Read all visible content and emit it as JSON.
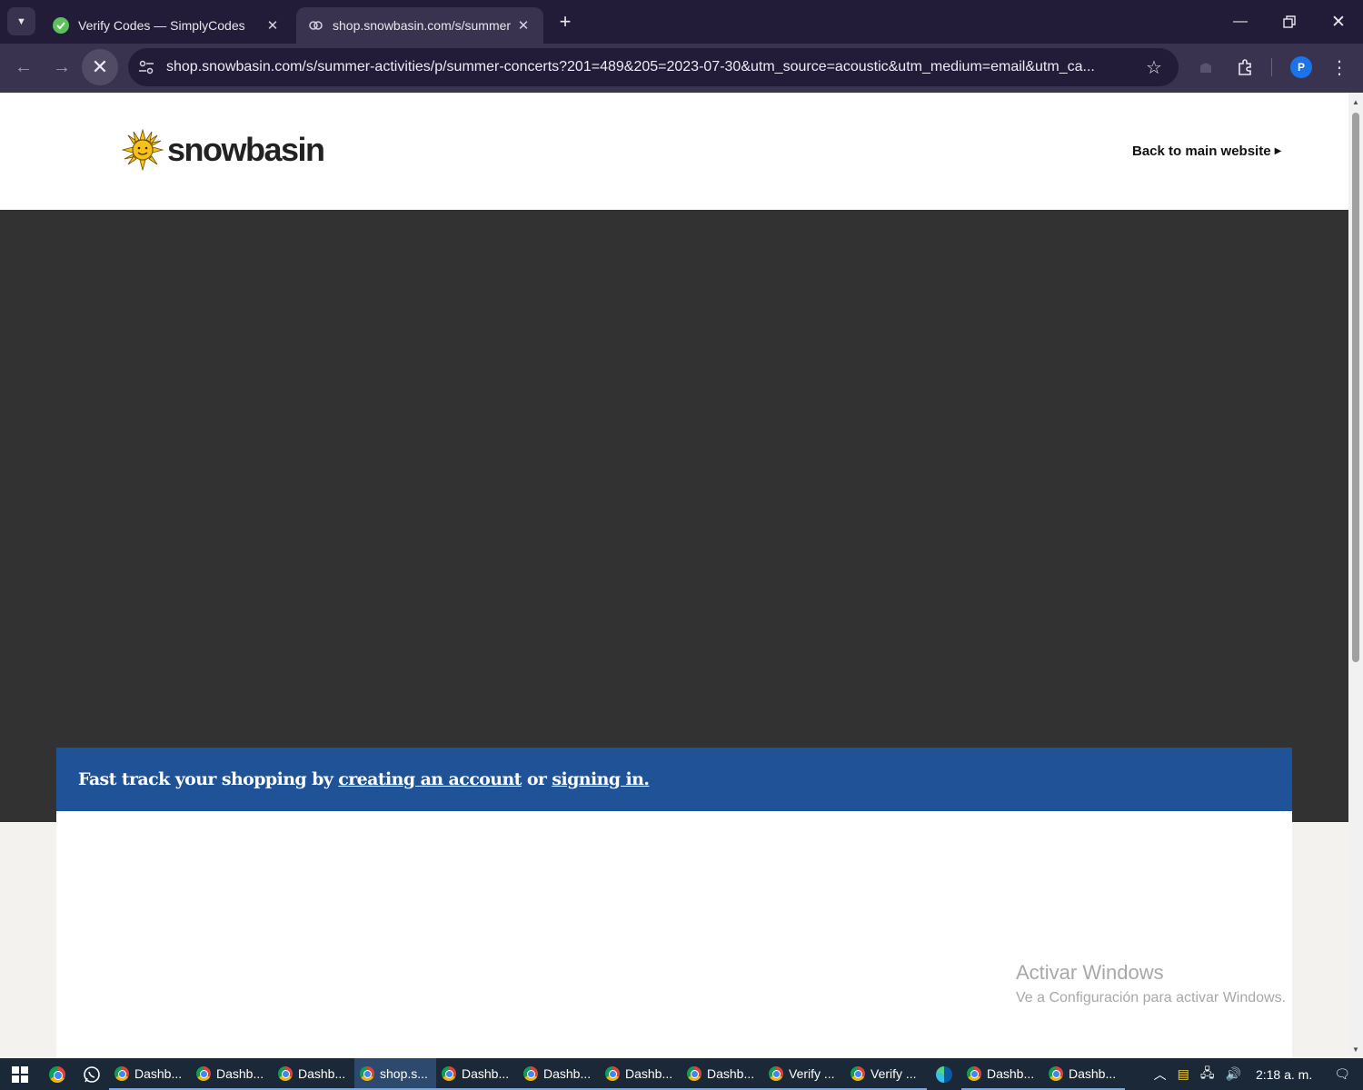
{
  "browser": {
    "tabs": [
      {
        "title": "Verify Codes — SimplyCodes",
        "active": false
      },
      {
        "title": "shop.snowbasin.com/s/summer",
        "active": true
      }
    ],
    "url": "shop.snowbasin.com/s/summer-activities/p/summer-concerts?201=489&205=2023-07-30&utm_source=acoustic&utm_medium=email&utm_ca...",
    "profile_initial": "P",
    "icons": {
      "tab_list": "chevron-down-icon",
      "new_tab": "plus-icon",
      "back": "arrow-left-icon",
      "forward": "arrow-right-icon",
      "stop": "close-icon",
      "site_info": "tune-icon",
      "bookmark": "star-icon",
      "extensions": "puzzle-icon"
    }
  },
  "page": {
    "logo_text": "snowbasin",
    "back_link": "Back to main website",
    "banner": {
      "prefix": "Fast track your shopping by ",
      "create_link": "creating an account",
      "middle": " or ",
      "signin_link": "signing in."
    },
    "colors": {
      "hero": "#323232",
      "banner": "#1f5296"
    }
  },
  "watermark": {
    "line1": "Activar Windows",
    "line2": "Ve a Configuración para activar Windows."
  },
  "taskbar": {
    "apps": [
      {
        "label": "Dashb...",
        "active": false
      },
      {
        "label": "Dashb...",
        "active": false
      },
      {
        "label": "Dashb...",
        "active": false
      },
      {
        "label": "shop.s...",
        "active": true
      },
      {
        "label": "Dashb...",
        "active": false
      },
      {
        "label": "Dashb...",
        "active": false
      },
      {
        "label": "Dashb...",
        "active": false
      },
      {
        "label": "Dashb...",
        "active": false
      },
      {
        "label": "Verify ...",
        "active": false
      },
      {
        "label": "Verify ...",
        "active": false
      }
    ],
    "apps_after_edge": [
      {
        "label": "Dashb...",
        "active": false
      },
      {
        "label": "Dashb...",
        "active": false
      }
    ],
    "clock": "2:18 a. m."
  }
}
